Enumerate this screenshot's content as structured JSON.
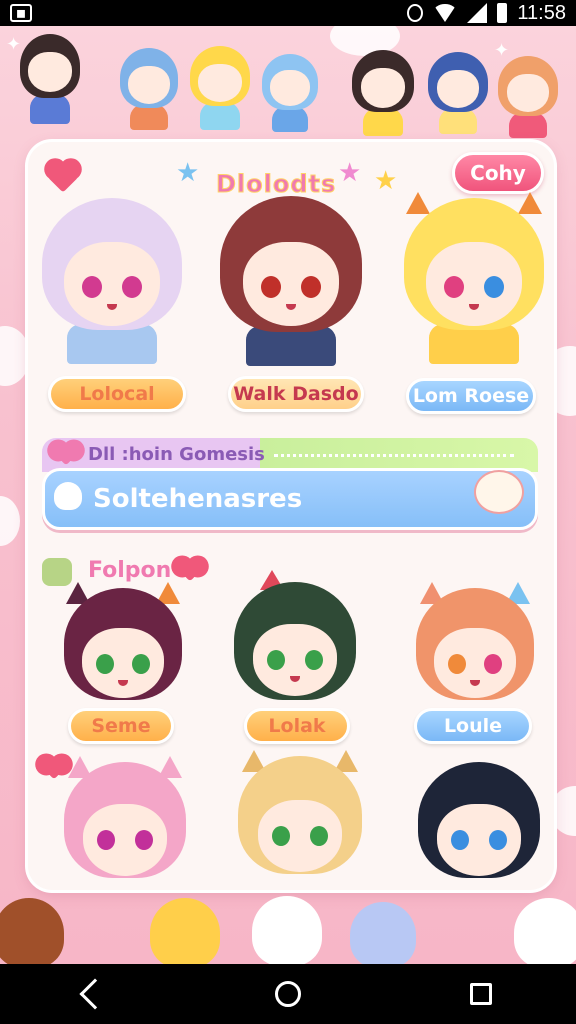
{
  "status_bar": {
    "time": "11:58"
  },
  "panel": {
    "title": "Dlolodts",
    "copy_button": "Cohy",
    "top_characters": [
      {
        "name": "Lolocal"
      },
      {
        "name": "Walk Dasdo"
      },
      {
        "name": "Lom Roese"
      }
    ],
    "search": {
      "subtitle": "Dll :hoin Gomesis",
      "value": "Soltehenasres"
    },
    "section_label": "Folpon",
    "mid_characters": [
      {
        "name": "Seme"
      },
      {
        "name": "Lolak"
      },
      {
        "name": "Loule"
      }
    ]
  },
  "nav": {
    "back": "back",
    "home": "home",
    "recent": "recent"
  },
  "colors": {
    "accent": "#f0547c",
    "blue": "#86bff8",
    "panel": "#fdf6f4"
  }
}
